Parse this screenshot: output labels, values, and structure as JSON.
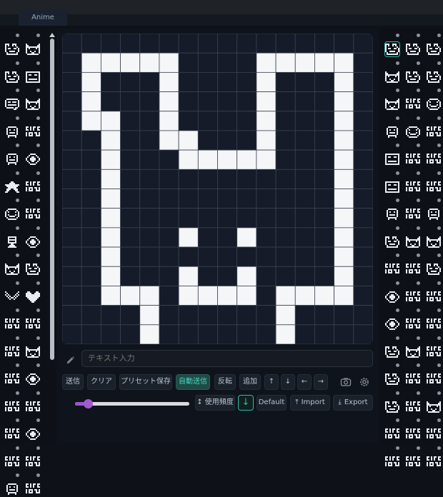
{
  "tabs": [
    {
      "label": "Anime"
    }
  ],
  "editor": {
    "rows": 16,
    "cols": 16,
    "pixels": [
      "0000000000000000",
      "0111110000111110",
      "0100010000100010",
      "0100010000100010",
      "0110010000100010",
      "0010011000100010",
      "0010001111100010",
      "0010000000000010",
      "0010000000000010",
      "0010000000000010",
      "0010001001000010",
      "0010000000000010",
      "0010001001000010",
      "0011101111011110",
      "0000100000010000",
      "0000100000010000"
    ],
    "colors": {
      "on": "#f4f6f8",
      "off": "#151b28",
      "gridline": "#3b4250"
    }
  },
  "text_input": {
    "placeholder": "テキスト入力"
  },
  "actions": {
    "send": "送信",
    "clear": "クリア",
    "preset_save": "プリセット保存",
    "auto_send": "自動送信",
    "invert": "反転",
    "add": "追加",
    "up": "↑",
    "down": "↓",
    "left": "←",
    "right": "→"
  },
  "bottom": {
    "sort_label": "↕ 使用頻度",
    "sort_direction": "↓",
    "default_label": "Default",
    "import_label": "Import",
    "export_label": "Export",
    "slider_value": 0.1
  },
  "accent_color": "#2fb9a7",
  "slider_color": "#9a56c8",
  "preset_icons": {
    "left": [
      "face",
      "cat",
      "face",
      "box",
      "bubble",
      "cat",
      "robot",
      "text",
      "robot",
      "eye",
      "star",
      "text",
      "smile",
      "text",
      "tall",
      "eye",
      "cat",
      "face",
      "wave",
      "heart",
      "text",
      "text",
      "text",
      "cat",
      "text",
      "eye",
      "text",
      "text",
      "text",
      "eye",
      "text",
      "text",
      "robot",
      "text"
    ],
    "right": [
      "face",
      "face",
      "face",
      "cat",
      "face",
      "face",
      "cat",
      "text",
      "smile",
      "robot",
      "smile",
      "text",
      "box",
      "text",
      "text",
      "box",
      "text",
      "text",
      "robot",
      "text",
      "robot",
      "face",
      "cat",
      "cat",
      "text",
      "text",
      "face",
      "eye",
      "text",
      "text",
      "eye",
      "text",
      "text",
      "face",
      "cat",
      "text",
      "face",
      "text",
      "text",
      "face",
      "text",
      "cat",
      "text",
      "text",
      "text",
      "text",
      "text",
      "text"
    ]
  }
}
